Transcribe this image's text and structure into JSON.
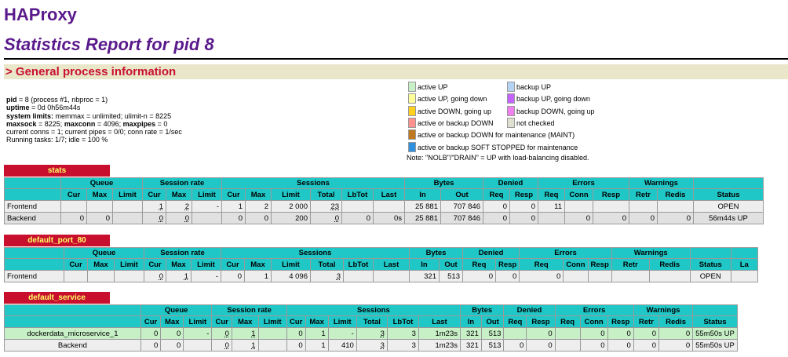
{
  "header": {
    "title": "HAProxy",
    "subtitle": "Statistics Report for pid 8"
  },
  "section": {
    "label": "> General process information"
  },
  "info": {
    "pid_label": "pid",
    "pid_value": "= 8 (process #1, nbproc = 1)",
    "uptime_label": "uptime",
    "uptime_value": "= 0d 0h56m44s",
    "limits_label": "system limits:",
    "limits_value": " memmax = unlimited; ulimit-n = 8225",
    "maxsock_label": "maxsock",
    "maxsock_value": " = 8225; ",
    "maxconn_label": "maxconn",
    "maxconn_value": " = 4096; ",
    "maxpipes_label": "maxpipes",
    "maxpipes_value": " = 0",
    "conns": "current conns = 1; current pipes = 0/0; conn rate = 1/sec",
    "tasks": "Running tasks: 1/7; idle = 100 %"
  },
  "legend": {
    "items": [
      {
        "label": "active UP",
        "color": "#c7f0c7"
      },
      {
        "label": "backup UP",
        "color": "#b4d3f2"
      },
      {
        "label": "active UP, going down",
        "color": "#ffff99"
      },
      {
        "label": "backup UP, going down",
        "color": "#c464ff"
      },
      {
        "label": "active DOWN, going up",
        "color": "#ffd020"
      },
      {
        "label": "backup DOWN, going up",
        "color": "#f080f0"
      },
      {
        "label": "active or backup DOWN",
        "color": "#ff9090"
      },
      {
        "label": "not checked",
        "color": "#e0e0d0"
      },
      {
        "label": "active or backup DOWN for maintenance (MAINT)",
        "color": "#c07820"
      },
      {
        "label": "active or backup SOFT STOPPED for maintenance",
        "color": "#3090e0"
      }
    ],
    "note": "Note: \"NOLB\"/\"DRAIN\" = UP with load-balancing disabled."
  },
  "headers": {
    "queue": "Queue",
    "session_rate": "Session rate",
    "sessions": "Sessions",
    "bytes": "Bytes",
    "denied": "Denied",
    "errors": "Errors",
    "warnings": "Warnings",
    "cur": "Cur",
    "max": "Max",
    "limit": "Limit",
    "total": "Total",
    "lbtot": "LbTot",
    "last": "Last",
    "in": "In",
    "out": "Out",
    "req": "Req",
    "resp": "Resp",
    "conn": "Conn",
    "retr": "Retr",
    "redis": "Redis",
    "status": "Status",
    "la": "La"
  },
  "proxies": [
    {
      "name": "stats",
      "rows": [
        {
          "name": "Frontend",
          "sr_cur": "1",
          "sr_max": "2",
          "sr_lim": "-",
          "s_cur": "1",
          "s_max": "2",
          "s_lim": "2 000",
          "s_tot": "23",
          "b_in": "25 881",
          "b_out": "707 846",
          "d_req": "0",
          "d_resp": "0",
          "e_req": "11",
          "status": "OPEN"
        },
        {
          "name": "Backend",
          "q_cur": "0",
          "q_max": "0",
          "sr_cur": "0",
          "sr_max": "0",
          "s_cur": "0",
          "s_max": "0",
          "s_lim": "200",
          "s_tot": "0",
          "s_lb": "0",
          "s_last": "0s",
          "b_in": "25 881",
          "b_out": "707 846",
          "d_req": "0",
          "d_resp": "0",
          "e_conn": "0",
          "e_resp": "0",
          "w_retr": "0",
          "w_redis": "0",
          "status": "56m44s UP"
        }
      ]
    },
    {
      "name": "default_port_80",
      "rows": [
        {
          "name": "Frontend",
          "sr_cur": "0",
          "sr_max": "1",
          "sr_lim": "-",
          "s_cur": "0",
          "s_max": "1",
          "s_lim": "4 096",
          "s_tot": "3",
          "b_in": "321",
          "b_out": "513",
          "d_req": "0",
          "d_resp": "0",
          "e_req": "0",
          "status": "OPEN"
        }
      ]
    },
    {
      "name": "default_service",
      "rows": [
        {
          "name": "dockerdata_microservice_1",
          "q_cur": "0",
          "q_max": "0",
          "q_lim": "-",
          "sr_cur": "0",
          "sr_max": "1",
          "s_cur": "0",
          "s_max": "1",
          "s_lim": "-",
          "s_tot": "3",
          "s_lb": "3",
          "s_last": "1m23s",
          "b_in": "321",
          "b_out": "513",
          "d_resp": "0",
          "e_conn": "0",
          "e_resp": "0",
          "w_retr": "0",
          "w_redis": "0",
          "status": "55m50s UP"
        },
        {
          "name": "Backend",
          "q_cur": "0",
          "q_max": "0",
          "sr_cur": "0",
          "sr_max": "1",
          "s_cur": "0",
          "s_max": "1",
          "s_lim": "410",
          "s_tot": "3",
          "s_lb": "3",
          "s_last": "1m23s",
          "b_in": "321",
          "b_out": "513",
          "d_req": "0",
          "d_resp": "0",
          "e_conn": "0",
          "e_resp": "0",
          "w_retr": "0",
          "w_redis": "0",
          "status": "55m50s UP"
        }
      ]
    }
  ]
}
